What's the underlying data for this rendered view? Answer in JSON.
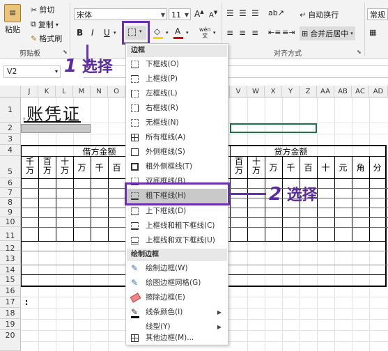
{
  "ribbon": {
    "clipboard": {
      "paste": "粘贴",
      "cut": "剪切",
      "copy": "复制",
      "format_painter": "格式刷",
      "group_label": "剪贴板"
    },
    "font": {
      "name": "宋体",
      "size": "11",
      "bold": "B",
      "italic": "I",
      "underline": "U",
      "phonetic": "wén"
    },
    "alignment": {
      "wrap_text": "自动换行",
      "merge_center": "合并后居中",
      "group_label": "对齐方式"
    },
    "number": {
      "format": "常规"
    }
  },
  "formula_bar": {
    "name_box": "V2"
  },
  "columns": [
    "J",
    "K",
    "L",
    "M",
    "N",
    "O",
    "V",
    "W",
    "X",
    "Y",
    "Z",
    "AA",
    "AB",
    "AC",
    "AD"
  ],
  "rows": [
    "1",
    "2",
    "3",
    "4",
    "5",
    "6",
    "7",
    "8",
    "9",
    "10",
    "11",
    "12",
    "13",
    "14",
    "15",
    "16",
    "17",
    "18",
    "19",
    "20"
  ],
  "sheet": {
    "title_fragment": "记账凭证",
    "debit_header": "借方金额",
    "credit_header": "贷方金额",
    "debit_units": [
      "千万",
      "百万",
      "十万",
      "万",
      "千",
      "百"
    ],
    "credit_units": [
      "百万",
      "十万",
      "万",
      "千",
      "百",
      "十",
      "元",
      "角",
      "分"
    ],
    "row17_text": ":"
  },
  "menu": {
    "section_border": "边框",
    "items": [
      "下框线(O)",
      "上框线(P)",
      "左框线(L)",
      "右框线(R)",
      "无框线(N)",
      "所有框线(A)",
      "外侧框线(S)",
      "粗外侧框线(T)",
      "双底框线(B)",
      "粗下框线(H)",
      "上下框线(D)",
      "上框线和粗下框线(C)",
      "上框线和双下框线(U)"
    ],
    "section_draw": "绘制边框",
    "draw_items": [
      "绘制边框(W)",
      "绘图边框网格(G)",
      "擦除边框(E)",
      "线条颜色(I)",
      "线型(Y)",
      "其他边框(M)..."
    ]
  },
  "callouts": {
    "step1_num": "1",
    "step1_text": "选择",
    "step2_num": "2",
    "step2_text": "选择"
  },
  "colors": {
    "callout": "#6b2fb3",
    "highlight": "#c9c9c9",
    "font_color_bar": "#e00000",
    "fill_color_bar": "#ffd200"
  }
}
